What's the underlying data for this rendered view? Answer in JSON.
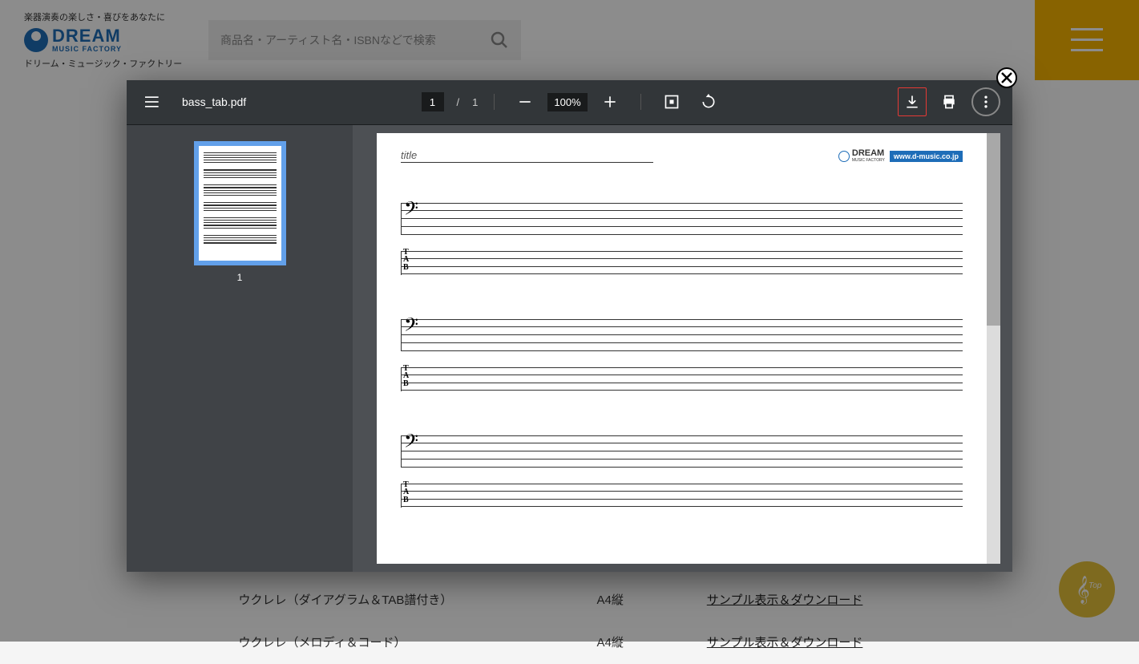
{
  "site": {
    "tagline": "楽器演奏の楽しさ・喜びをあなたに",
    "brand_main": "DREAM",
    "brand_sub": "MUSIC FACTORY",
    "brand_ja": "ドリーム・ミュージック・ファクトリー",
    "search_placeholder": "商品名・アーティスト名・ISBNなどで検索"
  },
  "bg_table": {
    "rows": [
      {
        "name": "ウクレレ（ダイアグラム＆TAB譜付き）",
        "size": "A4縦",
        "link": "サンプル表示＆ダウンロード"
      },
      {
        "name": "ウクレレ（メロディ＆コード）",
        "size": "A4縦",
        "link": "サンプル表示＆ダウンロード"
      }
    ]
  },
  "pdf": {
    "filename": "bass_tab.pdf",
    "page_current": "1",
    "page_total": "1",
    "zoom": "100%",
    "thumb_num": "1",
    "sheet": {
      "title_label": "title",
      "brand_main": "DREAM",
      "brand_sub": "MUSIC FACTORY",
      "brand_url": "www.d-music.co.jp",
      "tab_label": "T\nA\nB"
    }
  }
}
